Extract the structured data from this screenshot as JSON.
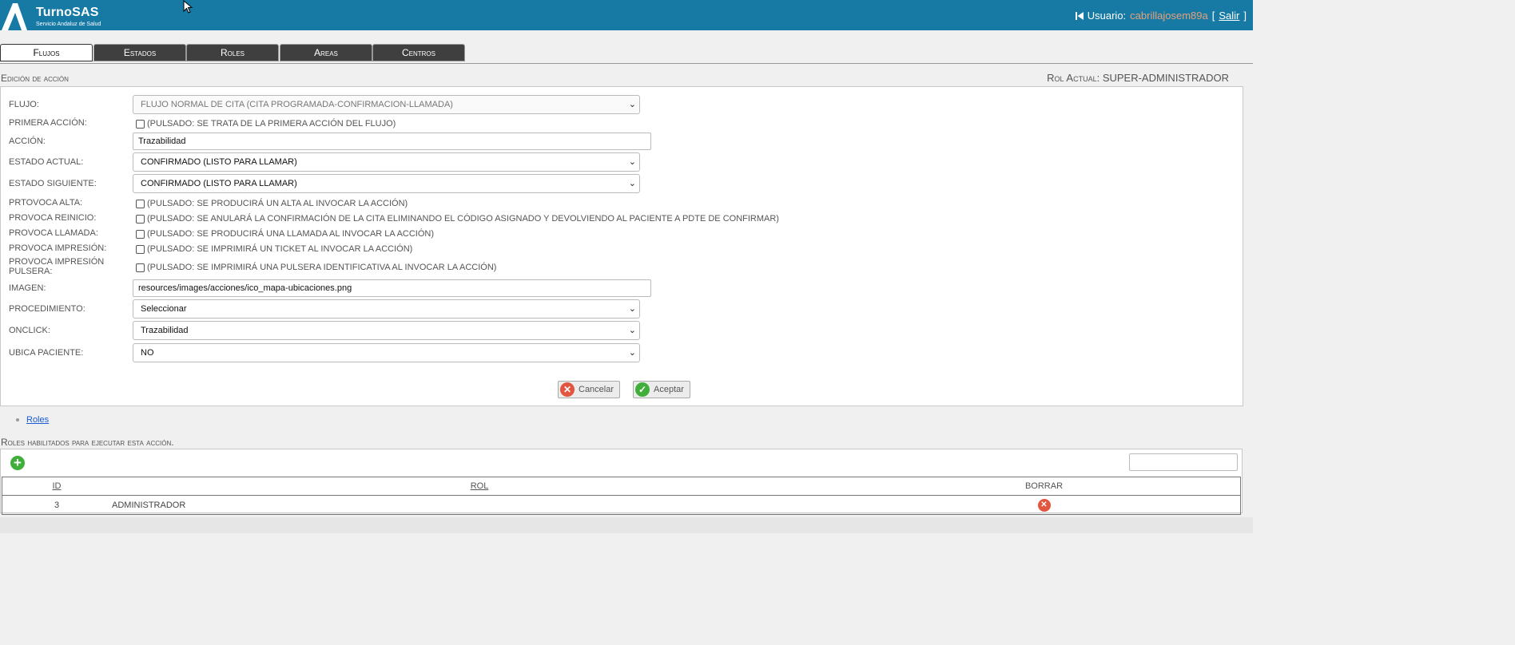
{
  "header": {
    "brand_title": "TurnoSAS",
    "brand_subtitle": "Servicio Andaluz de Salud",
    "user_label": "Usuario:",
    "user_name": "cabrillajosem89a",
    "logout_open": "[",
    "logout_label": "Salir",
    "logout_close": "]",
    "colors": {
      "bar": "#167aa5",
      "user_name": "#e5a27a"
    }
  },
  "tabs": [
    {
      "label": "Flujos",
      "active": true
    },
    {
      "label": "Estados",
      "active": false
    },
    {
      "label": "Roles",
      "active": false
    },
    {
      "label": "Areas",
      "active": false
    },
    {
      "label": "Centros",
      "active": false
    }
  ],
  "section": {
    "title": "Edición de acción",
    "role_current": "Rol Actual: SUPER-ADMINISTRADOR"
  },
  "form": {
    "flujo": {
      "label": "FLUJO:",
      "value": "FLUJO NORMAL DE CITA (CITA PROGRAMADA-CONFIRMACION-LLAMADA)"
    },
    "primera_accion": {
      "label": "PRIMERA ACCIÓN:",
      "text": "(PULSADO: SE TRATA DE LA PRIMERA ACCIÓN DEL FLUJO)",
      "checked": false
    },
    "accion": {
      "label": "ACCIÓN:",
      "value": "Trazabilidad"
    },
    "estado_actual": {
      "label": "ESTADO ACTUAL:",
      "value": "CONFIRMADO (LISTO PARA LLAMAR)"
    },
    "estado_siguiente": {
      "label": "ESTADO SIGUIENTE:",
      "value": "CONFIRMADO (LISTO PARA LLAMAR)"
    },
    "provoca_alta": {
      "label": "PRTOVOCA ALTA:",
      "text": "(PULSADO: SE PRODUCIRÁ UN ALTA AL INVOCAR LA ACCIÓN)",
      "checked": false
    },
    "provoca_reinicio": {
      "label": "PROVOCA REINICIO:",
      "text": "(PULSADO: SE ANULARÁ LA CONFIRMACIÓN DE LA CITA ELIMINANDO EL CÓDIGO ASIGNADO Y DEVOLVIENDO AL PACIENTE A PDTE DE CONFIRMAR)",
      "checked": false
    },
    "provoca_llamada": {
      "label": "PROVOCA LLAMADA:",
      "text": "(PULSADO: SE PRODUCIRÁ UNA LLAMADA AL INVOCAR LA ACCIÓN)",
      "checked": false
    },
    "provoca_impresion": {
      "label": "PROVOCA IMPRESIÓN:",
      "text": "(PULSADO: SE IMPRIMIRÁ UN TICKET AL INVOCAR LA ACCIÓN)",
      "checked": false
    },
    "provoca_impresion_pulsera": {
      "label_line1": "PROVOCA IMPRESIÓN",
      "label_line2": "PULSERA:",
      "text": "(PULSADO: SE IMPRIMIRÁ UNA PULSERA IDENTIFICATIVA AL INVOCAR LA ACCIÓN)",
      "checked": false
    },
    "imagen": {
      "label": "IMAGEN:",
      "value": "resources/images/acciones/ico_mapa-ubicaciones.png"
    },
    "procedimiento": {
      "label": "PROCEDIMIENTO:",
      "value": "Seleccionar"
    },
    "onclick": {
      "label": "ONCLICK:",
      "value": "Trazabilidad"
    },
    "ubica_paciente": {
      "label": "UBICA PACIENTE:",
      "value": "NO"
    },
    "cancel_label": "Cancelar",
    "accept_label": "Aceptar"
  },
  "breadcrumb": {
    "link": "Roles"
  },
  "roles": {
    "caption": "Roles habilitados para ejecutar esta acción.",
    "columns": {
      "id": "ID",
      "rol": "ROL",
      "borrar": "BORRAR"
    },
    "rows": [
      {
        "id": "3",
        "rol": "ADMINISTRADOR"
      }
    ]
  },
  "icons": {
    "add": "plus-circle-icon",
    "delete": "x-circle-icon",
    "cancel": "x-circle-icon",
    "accept": "check-circle-icon",
    "logout": "skip-back-icon",
    "select": "chevron-down-icon",
    "logo": "sas-logo-icon",
    "cursor": "mouse-pointer-icon"
  }
}
